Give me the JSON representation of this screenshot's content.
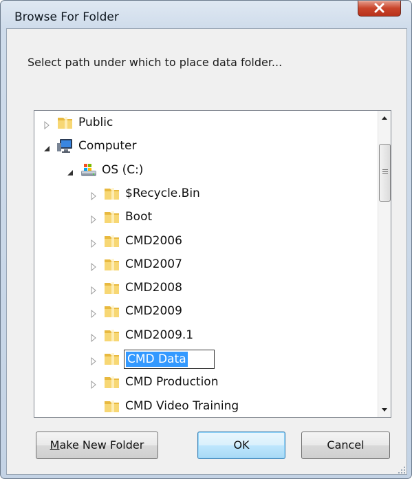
{
  "window": {
    "title": "Browse For Folder"
  },
  "prompt": "Select path under which to place data folder...",
  "tree": {
    "items": [
      {
        "label": "Public",
        "indent": 0,
        "expander": "collapsed",
        "icon": "folder-icon"
      },
      {
        "label": "Computer",
        "indent": 0,
        "expander": "expanded",
        "icon": "computer-icon"
      },
      {
        "label": "OS (C:)",
        "indent": 1,
        "expander": "expanded",
        "icon": "drive-icon"
      },
      {
        "label": "$Recycle.Bin",
        "indent": 2,
        "expander": "collapsed",
        "icon": "folder-icon"
      },
      {
        "label": "Boot",
        "indent": 2,
        "expander": "collapsed",
        "icon": "folder-icon"
      },
      {
        "label": "CMD2006",
        "indent": 2,
        "expander": "collapsed",
        "icon": "folder-icon"
      },
      {
        "label": "CMD2007",
        "indent": 2,
        "expander": "collapsed",
        "icon": "folder-icon"
      },
      {
        "label": "CMD2008",
        "indent": 2,
        "expander": "collapsed",
        "icon": "folder-icon"
      },
      {
        "label": "CMD2009",
        "indent": 2,
        "expander": "collapsed",
        "icon": "folder-icon"
      },
      {
        "label": "CMD2009.1",
        "indent": 2,
        "expander": "collapsed",
        "icon": "folder-icon"
      },
      {
        "label": "CMD Data",
        "indent": 2,
        "expander": "collapsed",
        "icon": "folder-icon",
        "editing": true
      },
      {
        "label": "CMD Production",
        "indent": 2,
        "expander": "collapsed",
        "icon": "folder-icon"
      },
      {
        "label": "CMD Video Training",
        "indent": 2,
        "expander": "none",
        "icon": "folder-icon"
      }
    ]
  },
  "buttons": {
    "make_new_folder": {
      "accel": "M",
      "rest": "ake New Folder"
    },
    "ok": "OK",
    "cancel": "Cancel"
  },
  "colors": {
    "selection": "#3399ff",
    "close_button": "#c9452b",
    "default_button_border": "#3c7fb1"
  }
}
